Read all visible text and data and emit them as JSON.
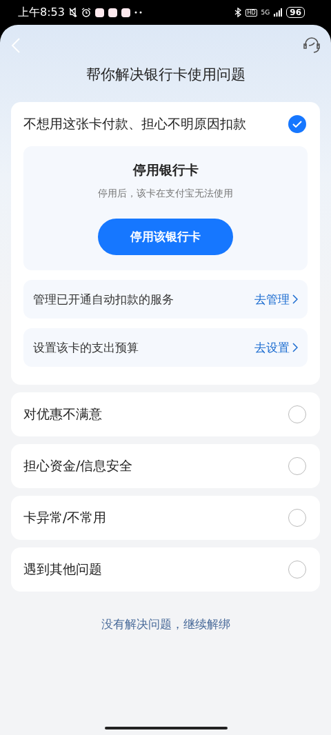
{
  "status_bar": {
    "time": "上午8:53",
    "hd": "HD",
    "network": "5G",
    "battery": "96"
  },
  "header": {
    "title": "帮你解决银行卡使用问题"
  },
  "reasons": [
    {
      "label": "不想用这张卡付款、担心不明原因扣款",
      "selected": true,
      "details": {
        "title": "停用银行卡",
        "subtitle": "停用后，该卡在支付宝无法使用",
        "button": "停用该银行卡",
        "links": [
          {
            "label": "管理已开通自动扣款的服务",
            "action": "去管理"
          },
          {
            "label": "设置该卡的支出预算",
            "action": "去设置"
          }
        ]
      }
    },
    {
      "label": "对优惠不满意",
      "selected": false
    },
    {
      "label": "担心资金/信息安全",
      "selected": false
    },
    {
      "label": "卡异常/不常用",
      "selected": false
    },
    {
      "label": "遇到其他问题",
      "selected": false
    }
  ],
  "footer_link": "没有解决问题，继续解绑"
}
